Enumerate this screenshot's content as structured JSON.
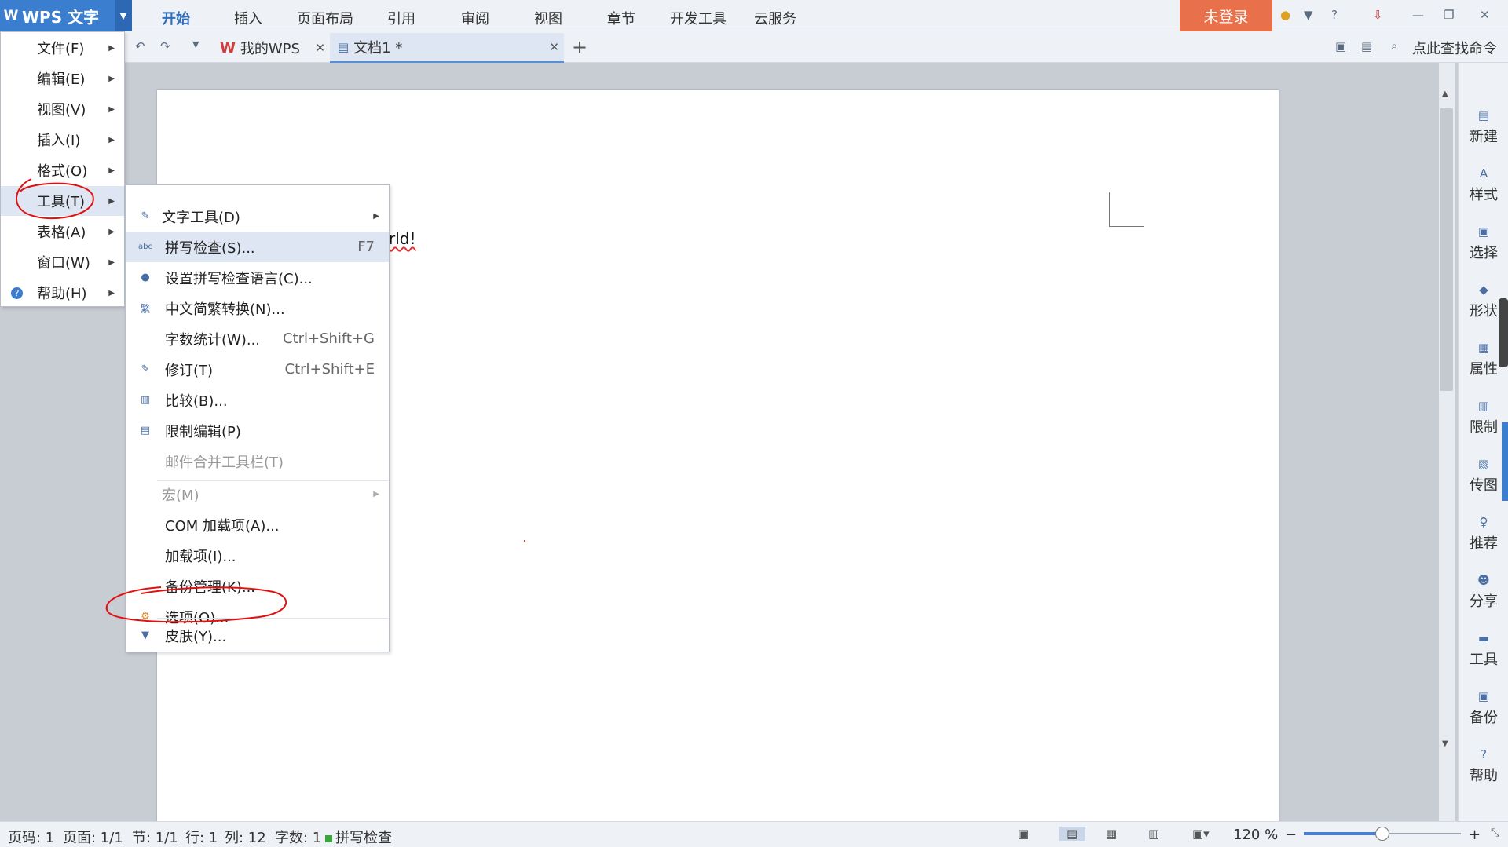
{
  "app": {
    "logo_text": "WPS 文字"
  },
  "ribbon_tabs": [
    "开始",
    "插入",
    "页面布局",
    "引用",
    "审阅",
    "视图",
    "章节",
    "开发工具",
    "云服务"
  ],
  "login_button": "未登录",
  "doc_tabs": [
    {
      "label": "我的WPS",
      "icon": "wps-icon"
    },
    {
      "label": "文档1 *",
      "icon": "document-icon"
    }
  ],
  "search_command": "点此查找命令",
  "document": {
    "visible_text": "rld!"
  },
  "main_menu": [
    {
      "label": "文件(F)"
    },
    {
      "label": "编辑(E)"
    },
    {
      "label": "视图(V)"
    },
    {
      "label": "插入(I)"
    },
    {
      "label": "格式(O)"
    },
    {
      "label": "工具(T)"
    },
    {
      "label": "表格(A)"
    },
    {
      "label": "窗口(W)"
    },
    {
      "label": "帮助(H)"
    }
  ],
  "tools_submenu": [
    {
      "label": "文字工具(D)",
      "shortcut": "",
      "icon": "text-tool-icon"
    },
    {
      "label": "拼写检查(S)...",
      "shortcut": "F7",
      "icon": "abc-icon"
    },
    {
      "label": "设置拼写检查语言(C)...",
      "shortcut": "",
      "icon": "globe-icon"
    },
    {
      "label": "中文简繁转换(N)...",
      "shortcut": "",
      "icon": "convert-icon"
    },
    {
      "label": "字数统计(W)...",
      "shortcut": "Ctrl+Shift+G",
      "icon": ""
    },
    {
      "label": "修订(T)",
      "shortcut": "Ctrl+Shift+E",
      "icon": "revision-icon"
    },
    {
      "label": "比较(B)...",
      "shortcut": "",
      "icon": "compare-icon"
    },
    {
      "label": "限制编辑(P)",
      "shortcut": "",
      "icon": "lock-doc-icon"
    },
    {
      "label": "邮件合并工具栏(T)",
      "shortcut": "",
      "icon": ""
    },
    {
      "label": "宏(M)",
      "shortcut": "",
      "icon": ""
    },
    {
      "label": "COM 加载项(A)...",
      "shortcut": "",
      "icon": ""
    },
    {
      "label": "加载项(I)...",
      "shortcut": "",
      "icon": ""
    },
    {
      "label": "备份管理(K)...",
      "shortcut": "",
      "icon": ""
    },
    {
      "label": "选项(O)...",
      "shortcut": "",
      "icon": "gear-icon"
    },
    {
      "label": "皮肤(Y)...",
      "shortcut": "",
      "icon": "shirt-icon"
    }
  ],
  "sidebar": [
    "新建",
    "样式",
    "选择",
    "形状",
    "属性",
    "限制",
    "传图",
    "推荐",
    "分享",
    "工具",
    "备份",
    "帮助"
  ],
  "status": {
    "page_no": "页码: 1",
    "pages": "页面: 1/1",
    "section": "节: 1/1",
    "line": "行: 1",
    "column": "列: 12",
    "word_count": "字数: 1",
    "spell_check": "拼写检查",
    "zoom": "120 %"
  },
  "zoom_fraction": 0.5,
  "colors": {
    "accent": "#3b7ed0",
    "login": "#e8704a",
    "annotation": "#e01010"
  }
}
